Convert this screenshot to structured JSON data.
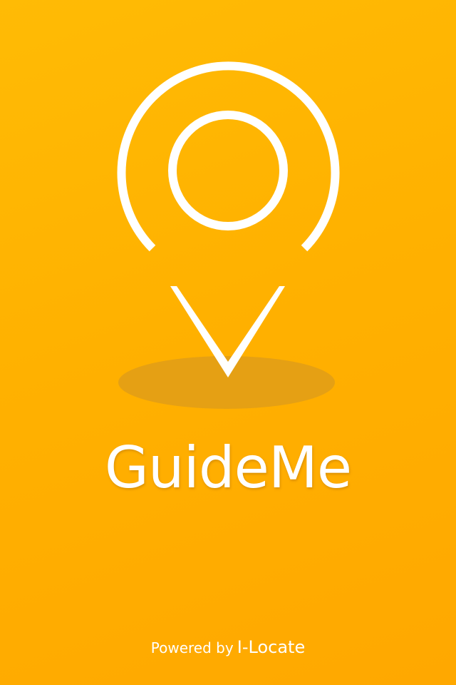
{
  "app": {
    "name": "GuideMe"
  },
  "footer": {
    "powered_prefix": "Powered by",
    "brand": "I-Locate"
  },
  "theme": {
    "background": "#ffb100",
    "foreground": "#ffffff",
    "shadow": "#e29f16"
  },
  "icons": {
    "logo": "location-pin-icon"
  }
}
